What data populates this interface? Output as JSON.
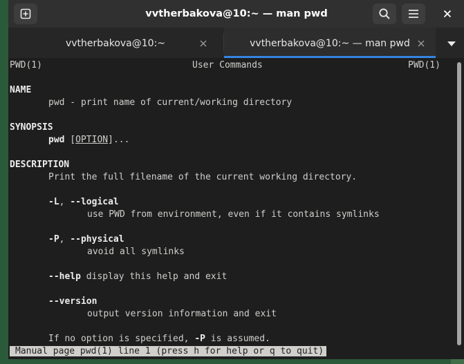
{
  "window": {
    "title": "vvtherbakova@10:~ — man pwd",
    "icons": {
      "new_tab": "new-tab-icon",
      "search": "search-icon",
      "menu": "hamburger-menu-icon",
      "close": "close-icon",
      "tabs_menu": "chevron-down-icon"
    }
  },
  "tabs": [
    {
      "label": "vvtherbakova@10:~",
      "active": false
    },
    {
      "label": "vvtherbakova@10:~ — man pwd",
      "active": true
    }
  ],
  "colors": {
    "accent": "#3584e4",
    "terminal_bg": "#1e1e1e",
    "terminal_fg": "#d0cfcc",
    "headerbar": "#303030"
  },
  "terminal": {
    "header_left": "PWD(1)",
    "header_center": "User Commands",
    "header_right": "PWD(1)",
    "name_heading": "NAME",
    "name_text": "pwd - print name of current/working directory",
    "synopsis_heading": "SYNOPSIS",
    "synopsis_cmd": "pwd",
    "synopsis_option": "OPTION",
    "synopsis_tail": "...",
    "description_heading": "DESCRIPTION",
    "description_text": "Print the full filename of the current working directory.",
    "opt_l_short": "-L",
    "opt_l_long": "--logical",
    "opt_l_desc": "use PWD from environment, even if it contains symlinks",
    "opt_p_short": "-P",
    "opt_p_long": "--physical",
    "opt_p_desc": "avoid all symlinks",
    "help_flag": "--help",
    "help_desc": " display this help and exit",
    "version_flag": "--version",
    "version_desc": "output version information and exit",
    "noopt_pre": "If no option is specified, ",
    "noopt_flag": "-P",
    "noopt_post": " is assumed.",
    "status_line": "Manual page pwd(1) line 1 (press h for help or q to quit)"
  }
}
